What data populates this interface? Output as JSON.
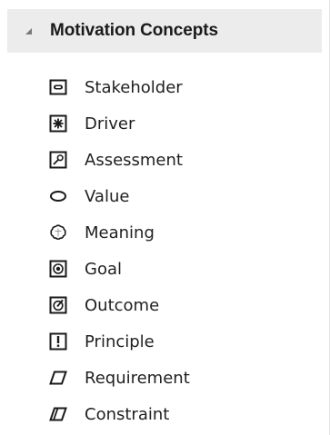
{
  "group": {
    "title": "Motivation Concepts",
    "expanded": true
  },
  "items": [
    {
      "label": "Stakeholder",
      "icon": "stakeholder-icon"
    },
    {
      "label": "Driver",
      "icon": "driver-icon"
    },
    {
      "label": "Assessment",
      "icon": "assessment-icon"
    },
    {
      "label": "Value",
      "icon": "value-icon"
    },
    {
      "label": "Meaning",
      "icon": "meaning-icon"
    },
    {
      "label": "Goal",
      "icon": "goal-icon"
    },
    {
      "label": "Outcome",
      "icon": "outcome-icon"
    },
    {
      "label": "Principle",
      "icon": "principle-icon"
    },
    {
      "label": "Requirement",
      "icon": "requirement-icon"
    },
    {
      "label": "Constraint",
      "icon": "constraint-icon"
    }
  ],
  "colors": {
    "header_bg": "#ececec",
    "icon_stroke": "#1a1a1a",
    "text": "#1f1f1f"
  }
}
